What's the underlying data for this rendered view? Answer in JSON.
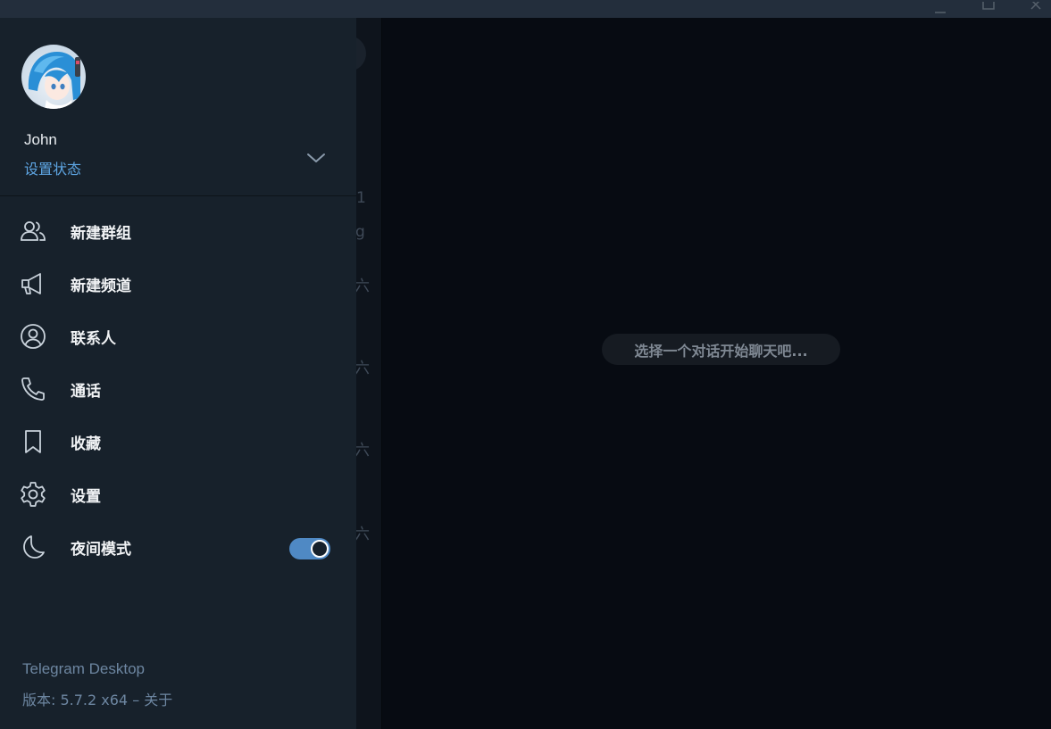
{
  "colors": {
    "drawer_bg": "#17212b",
    "accent": "#5ea6e4",
    "toggle_on": "#4f89c4",
    "main_bg": "#070b12"
  },
  "window": {
    "controls": [
      "minimize-icon",
      "maximize-icon",
      "close-icon"
    ]
  },
  "drawer": {
    "user": {
      "name": "John",
      "status": "设置状态"
    },
    "menu": [
      {
        "label": "新建群组",
        "icon": "group-icon"
      },
      {
        "label": "新建频道",
        "icon": "megaphone-icon"
      },
      {
        "label": "联系人",
        "icon": "contact-icon"
      },
      {
        "label": "通话",
        "icon": "phone-icon"
      },
      {
        "label": "收藏",
        "icon": "bookmark-icon"
      },
      {
        "label": "设置",
        "icon": "gear-icon"
      },
      {
        "label": "夜间模式",
        "icon": "moon-icon",
        "toggle_on": true
      }
    ],
    "footer": {
      "app_name": "Telegram Desktop",
      "version": "版本: 5.7.2 x64",
      "about": "– 关于"
    }
  },
  "chatlist_ghost": [
    "1",
    "g",
    "六",
    "六",
    "六",
    "六"
  ],
  "main": {
    "empty_text": "选择一个对话开始聊天吧..."
  }
}
